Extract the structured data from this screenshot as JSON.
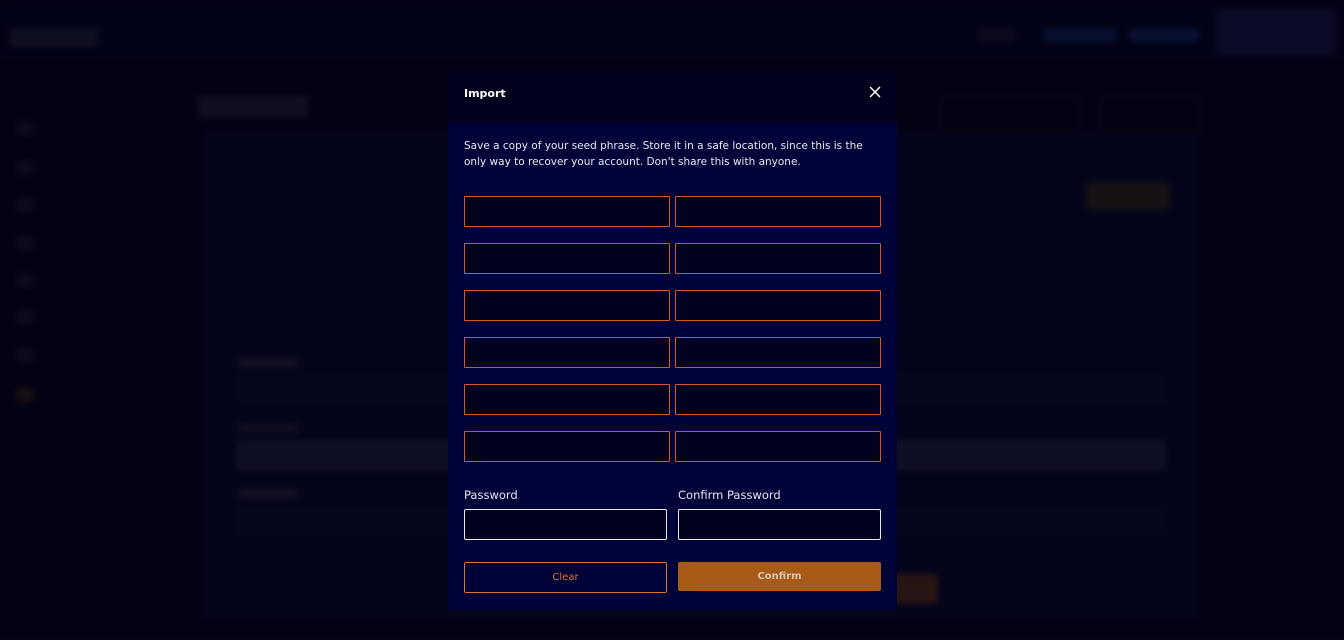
{
  "modal": {
    "title": "Import",
    "description": "Save a copy of your seed phrase. Store it in a safe location, since this is the only way to recover your account. Don't share this with anyone.",
    "seed_words": [
      "",
      "",
      "",
      "",
      "",
      "",
      "",
      "",
      "",
      "",
      "",
      ""
    ],
    "password_label": "Password",
    "confirm_password_label": "Confirm Password",
    "password_value": "",
    "confirm_password_value": "",
    "clear_label": "Clear",
    "confirm_label": "Confirm"
  },
  "colors": {
    "modal_bg": "#000338",
    "accent_orange": "#a85a19",
    "seed_border": "#d4572e"
  },
  "icons": {
    "close": "close-icon"
  }
}
